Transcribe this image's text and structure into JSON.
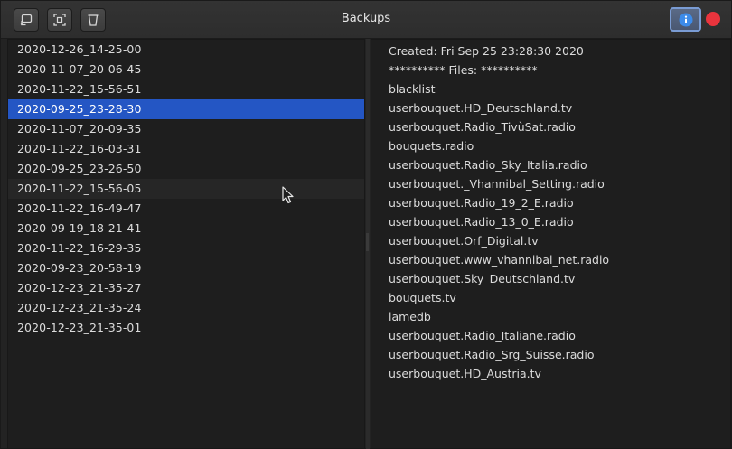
{
  "window": {
    "title": "Backups"
  },
  "toolbar": {
    "buttons": [
      {
        "icon": "restore-icon"
      },
      {
        "icon": "screenshot-icon"
      },
      {
        "icon": "trash-icon"
      }
    ],
    "info_icon": "info-icon",
    "close_icon": "close-icon"
  },
  "backups": {
    "selected": "2020-09-25_23-28-30",
    "items": [
      "2020-12-26_14-25-00",
      "2020-11-07_20-06-45",
      "2020-11-22_15-56-51",
      "2020-09-25_23-28-30",
      "2020-11-07_20-09-35",
      "2020-11-22_16-03-31",
      "2020-09-25_23-26-50",
      "2020-11-22_15-56-05",
      "2020-11-22_16-49-47",
      "2020-09-19_18-21-41",
      "2020-11-22_16-29-35",
      "2020-09-23_20-58-19",
      "2020-12-23_21-35-27",
      "2020-12-23_21-35-24",
      "2020-12-23_21-35-01"
    ]
  },
  "details": {
    "created": "Created: Fri Sep 25 23:28:30 2020",
    "files_header": "********** Files: **********",
    "files": [
      "blacklist",
      "userbouquet.HD_Deutschland.tv",
      "userbouquet.Radio_TivùSat.radio",
      "bouquets.radio",
      "userbouquet.Radio_Sky_Italia.radio",
      "userbouquet._Vhannibal_Setting.radio",
      "userbouquet.Radio_19_2_E.radio",
      "userbouquet.Radio_13_0_E.radio",
      "userbouquet.Orf_Digital.tv",
      "userbouquet.www_vhannibal_net.radio",
      "userbouquet.Sky_Deutschland.tv",
      "bouquets.tv",
      "lamedb",
      "userbouquet.Radio_Italiane.radio",
      "userbouquet.Radio_Srg_Suisse.radio",
      "userbouquet.HD_Austria.tv"
    ]
  },
  "colors": {
    "selection": "#2456c4",
    "close": "#e9343d",
    "info_button": "#5a6a86"
  }
}
